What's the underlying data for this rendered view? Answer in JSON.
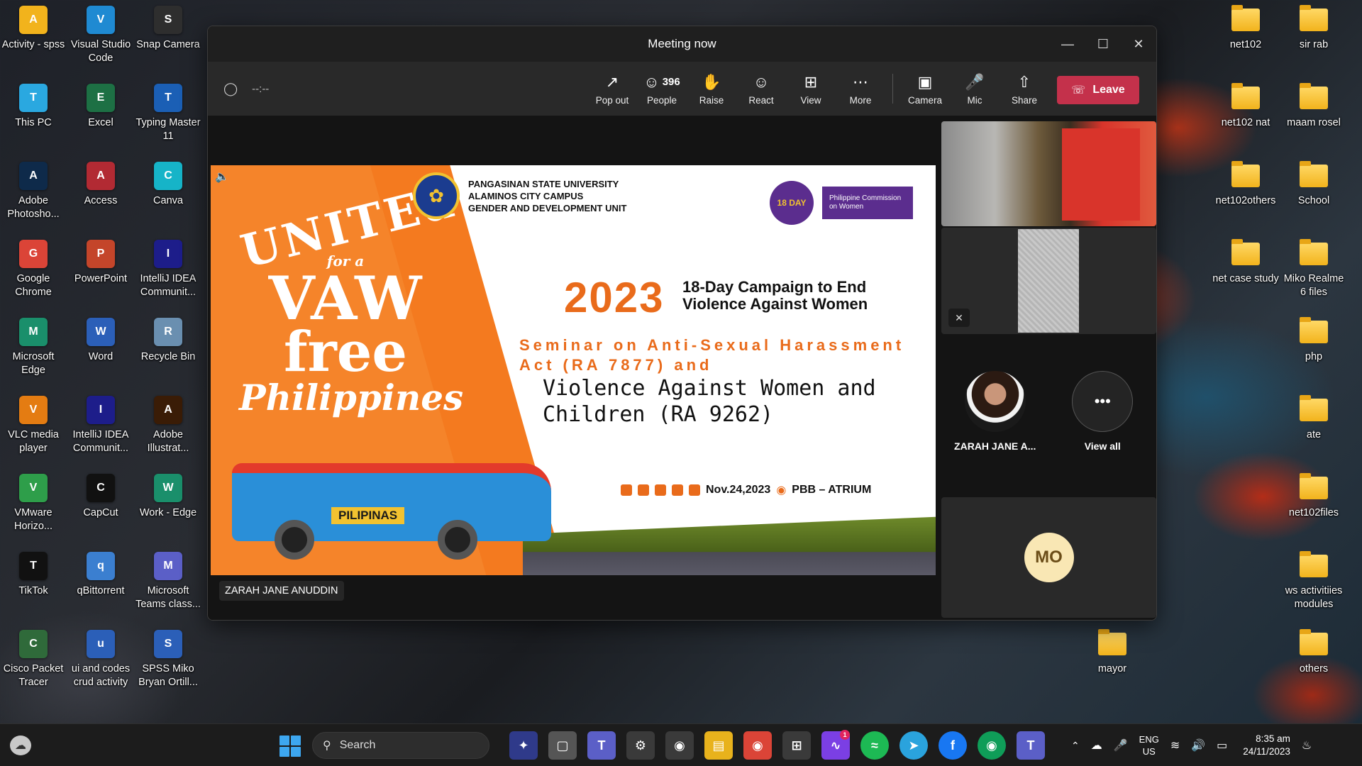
{
  "desktop": {
    "left_icons": [
      {
        "label": "Activity - spss",
        "icon": "folder-icon",
        "color": "#f2b31c"
      },
      {
        "label": "Visual Studio Code",
        "icon": "vscode-icon",
        "color": "#1f8ad2"
      },
      {
        "label": "Snap Camera",
        "icon": "snap-camera-icon",
        "color": "#2e2e2e"
      },
      {
        "label": "This PC",
        "icon": "monitor-icon",
        "color": "#2aa8e0"
      },
      {
        "label": "Excel",
        "icon": "excel-icon",
        "color": "#1d7044"
      },
      {
        "label": "Typing Master 11",
        "icon": "typing-master-icon",
        "color": "#1b5fb5"
      },
      {
        "label": "Adobe Photosho...",
        "icon": "photoshop-icon",
        "color": "#0e2a4a"
      },
      {
        "label": "Access",
        "icon": "access-icon",
        "color": "#b22a33"
      },
      {
        "label": "Canva",
        "icon": "canva-icon",
        "color": "#16b4c8"
      },
      {
        "label": "Google Chrome",
        "icon": "chrome-icon",
        "color": "#db4437"
      },
      {
        "label": "PowerPoint",
        "icon": "powerpoint-icon",
        "color": "#c4452a"
      },
      {
        "label": "IntelliJ IDEA Communit...",
        "icon": "intellij-icon",
        "color": "#1d1d8a"
      },
      {
        "label": "Microsoft Edge",
        "icon": "edge-icon",
        "color": "#1a8f6b"
      },
      {
        "label": "Word",
        "icon": "word-icon",
        "color": "#2b5fb8"
      },
      {
        "label": "Recycle Bin",
        "icon": "recycle-bin-icon",
        "color": "#6a8fb0"
      },
      {
        "label": "VLC media player",
        "icon": "vlc-icon",
        "color": "#e47c12"
      },
      {
        "label": "IntelliJ IDEA Communit...",
        "icon": "intellij-icon",
        "color": "#1d1d8a"
      },
      {
        "label": "Adobe Illustrat...",
        "icon": "illustrator-icon",
        "color": "#3a1c06"
      },
      {
        "label": "VMware Horizo...",
        "icon": "vmware-icon",
        "color": "#2e9e4a"
      },
      {
        "label": "CapCut",
        "icon": "capcut-icon",
        "color": "#111111"
      },
      {
        "label": "Work - Edge",
        "icon": "edge-icon",
        "color": "#1a8f6b"
      },
      {
        "label": "TikTok",
        "icon": "tiktok-icon",
        "color": "#111111"
      },
      {
        "label": "qBittorrent",
        "icon": "qbittorrent-icon",
        "color": "#3b7fd0"
      },
      {
        "label": "Microsoft Teams class...",
        "icon": "teams-icon",
        "color": "#5b5fc7"
      },
      {
        "label": "Cisco Packet Tracer",
        "icon": "packet-tracer-icon",
        "color": "#2f6a3a"
      },
      {
        "label": "ui and codes crud activity",
        "icon": "word-doc-icon",
        "color": "#2b5fb8"
      },
      {
        "label": "SPSS Miko Bryan Ortill...",
        "icon": "word-doc-icon",
        "color": "#2b5fb8"
      }
    ],
    "right_icons": [
      {
        "label": "net102"
      },
      {
        "label": "sir rab"
      },
      {
        "label": "net102 nat"
      },
      {
        "label": "maam rosel"
      },
      {
        "label": "net102others"
      },
      {
        "label": "School"
      },
      {
        "label": "net case study"
      },
      {
        "label": "Miko Realme 6 files"
      },
      {
        "label": "php"
      },
      {
        "label": "ate"
      },
      {
        "label": "net102files"
      },
      {
        "label": "ws activitiies modules"
      },
      {
        "label": "mayor"
      },
      {
        "label": "others"
      }
    ]
  },
  "window": {
    "title": "Meeting now",
    "timer": "--:--",
    "toolbar": {
      "pop_out": "Pop out",
      "people_count": "396",
      "people": "People",
      "raise": "Raise",
      "react": "React",
      "view": "View",
      "more": "More",
      "camera": "Camera",
      "mic": "Mic",
      "share": "Share",
      "leave": "Leave"
    },
    "presenter_name": "ZARAH JANE ANUDDIN",
    "slide": {
      "united": "UNITEd",
      "for_a": "for a",
      "vaw": "VAW",
      "free": "free",
      "philippines": "Philippines",
      "jeep_text": "PILIPINAS",
      "univ_line1": "PANGASINAN STATE UNIVERSITY",
      "univ_line2": "ALAMINOS CITY CAMPUS",
      "univ_line3": "GENDER AND DEVELOPMENT UNIT",
      "day18": "18 DAY",
      "pcw": "Philippine Commission on Women",
      "year": "2023",
      "campaign": "18-Day Campaign to End Violence Against Women",
      "seminar": "Seminar on Anti-Sexual Harassment Act (RA 7877) and",
      "vawc": "Violence Against Women and Children (RA 9262)",
      "date": "Nov.24,2023",
      "venue": "PBB – ATRIUM"
    },
    "gallery": {
      "participant_name": "ZARAH JANE A...",
      "view_all": "View all",
      "initials": "MO"
    }
  },
  "taskbar": {
    "search": "Search",
    "language": "ENG",
    "region": "US",
    "time": "8:35 am",
    "date": "24/11/2023",
    "messenger_badge": "1"
  }
}
